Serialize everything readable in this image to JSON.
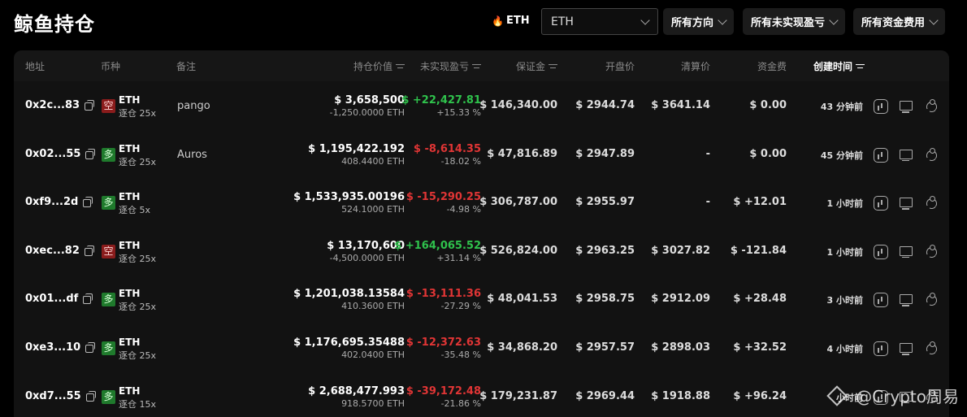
{
  "header": {
    "title": "鲸鱼持仓",
    "symbol_tag": "ETH",
    "symbol_select": "ETH",
    "filters": [
      "所有方向",
      "所有未实现盈亏",
      "所有资金费用"
    ]
  },
  "table": {
    "columns": {
      "address": "地址",
      "coin": "币种",
      "note": "备注",
      "position_value": "持仓价值",
      "unrealized_pnl": "未实现盈亏",
      "margin": "保证金",
      "entry_price": "开盘价",
      "liq_price": "清算价",
      "funding": "资金费",
      "created": "创建时间"
    },
    "rows": [
      {
        "address": "0x2c...83",
        "side": "空",
        "side_type": "short",
        "coin": "ETH",
        "mode": "逐仓 25x",
        "note": "pango",
        "value": "$ 3,658,500",
        "size": "-1,250.0000 ETH",
        "pnl": "$ +22,427.81",
        "pnl_pct": "+15.33 %",
        "pnl_type": "green",
        "margin": "$ 146,340.00",
        "entry": "$ 2944.74",
        "liq": "$ 3641.14",
        "funding": "$ 0.00",
        "funding_type": "neutral",
        "created": "43 分钟前"
      },
      {
        "address": "0x02...55",
        "side": "多",
        "side_type": "long",
        "coin": "ETH",
        "mode": "逐仓 25x",
        "note": "Auros",
        "value": "$ 1,195,422.192",
        "size": "408.4400 ETH",
        "pnl": "$ -8,614.35",
        "pnl_pct": "-18.02 %",
        "pnl_type": "red",
        "margin": "$ 47,816.89",
        "entry": "$ 2947.89",
        "liq": "-",
        "funding": "$ 0.00",
        "funding_type": "neutral",
        "created": "45 分钟前"
      },
      {
        "address": "0xf9...2d",
        "side": "多",
        "side_type": "long",
        "coin": "ETH",
        "mode": "逐仓 5x",
        "note": "",
        "value": "$ 1,533,935.00196",
        "size": "524.1000 ETH",
        "pnl": "$ -15,290.25",
        "pnl_pct": "-4.98 %",
        "pnl_type": "red",
        "margin": "$ 306,787.00",
        "entry": "$ 2955.97",
        "liq": "-",
        "funding": "$ +12.01",
        "funding_type": "green",
        "created": "1 小时前"
      },
      {
        "address": "0xec...82",
        "side": "空",
        "side_type": "short",
        "coin": "ETH",
        "mode": "逐仓 25x",
        "note": "",
        "value": "$ 13,170,600",
        "size": "-4,500.0000 ETH",
        "pnl": "$ +164,065.52",
        "pnl_pct": "+31.14 %",
        "pnl_type": "green",
        "margin": "$ 526,824.00",
        "entry": "$ 2963.25",
        "liq": "$ 3027.82",
        "funding": "$ -121.84",
        "funding_type": "red",
        "created": "1 小时前"
      },
      {
        "address": "0x01...df",
        "side": "多",
        "side_type": "long",
        "coin": "ETH",
        "mode": "逐仓 25x",
        "note": "",
        "value": "$ 1,201,038.13584",
        "size": "410.3600 ETH",
        "pnl": "$ -13,111.36",
        "pnl_pct": "-27.29 %",
        "pnl_type": "red",
        "margin": "$ 48,041.53",
        "entry": "$ 2958.75",
        "liq": "$ 2912.09",
        "funding": "$ +28.48",
        "funding_type": "green",
        "created": "3 小时前"
      },
      {
        "address": "0xe3...10",
        "side": "多",
        "side_type": "long",
        "coin": "ETH",
        "mode": "逐仓 25x",
        "note": "",
        "value": "$ 1,176,695.35488",
        "size": "402.0400 ETH",
        "pnl": "$ -12,372.63",
        "pnl_pct": "-35.48 %",
        "pnl_type": "red",
        "margin": "$ 34,868.20",
        "entry": "$ 2957.57",
        "liq": "$ 2898.03",
        "funding": "$ +32.52",
        "funding_type": "green",
        "created": "4 小时前"
      },
      {
        "address": "0xd7...55",
        "side": "多",
        "side_type": "long",
        "coin": "ETH",
        "mode": "逐仓 15x",
        "note": "",
        "value": "$ 2,688,477.993",
        "size": "918.5700 ETH",
        "pnl": "$ -39,172.48",
        "pnl_pct": "-21.86 %",
        "pnl_type": "red",
        "margin": "$ 179,231.87",
        "entry": "$ 2969.44",
        "liq": "$ 1918.88",
        "funding": "$ +96.24",
        "funding_type": "green",
        "created": "小时前"
      }
    ]
  },
  "watermark": "@Crypto周易",
  "icons": {
    "flame": "flame-icon",
    "copy": "copy-icon",
    "chart": "chart-icon",
    "monitor": "monitor-icon",
    "share": "share-icon",
    "sort": "sort-icon"
  },
  "colors": {
    "background": "#000000",
    "panel": "#121212",
    "green": "#2fc24c",
    "red": "#e03535",
    "short_badge": "#8a1c1c",
    "long_badge": "#1f7a2c"
  }
}
